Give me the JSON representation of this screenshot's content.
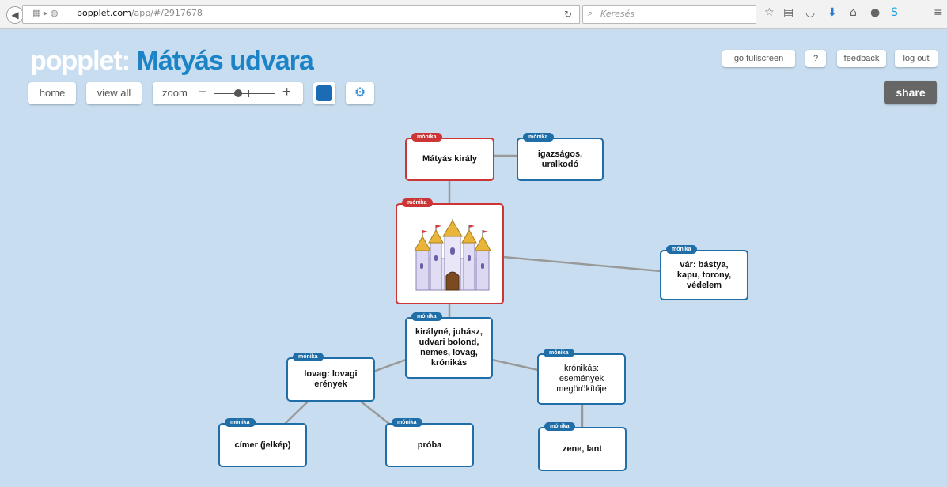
{
  "browser": {
    "url_domain": "popplet.com",
    "url_path": "/app/#/2917678",
    "search_placeholder": "Keresés"
  },
  "app": {
    "brand": "popplet",
    "colon": ":",
    "board_title": "Mátyás udvara"
  },
  "toolbar": {
    "home": "home",
    "view_all": "view all",
    "zoom": "zoom",
    "zoom_minus": "−",
    "zoom_plus": "+",
    "color": "#1b6cb5",
    "settings_icon": "⚙"
  },
  "top_right": {
    "fullscreen": "go fullscreen",
    "help": "?",
    "feedback": "feedback",
    "logout": "log out",
    "share": "share"
  },
  "popplets": [
    {
      "id": "matyas",
      "author": "mónika",
      "text": "Mátyás király",
      "border": "red"
    },
    {
      "id": "igazsagos",
      "author": "mónika",
      "text": "igazságos,\nuralkodó",
      "border": "blue"
    },
    {
      "id": "castle",
      "author": "mónika",
      "text": "",
      "border": "red",
      "icon": "castle-image"
    },
    {
      "id": "var",
      "author": "mónika",
      "text": "vár: bástya,\nkapu, torony,\nvédelem",
      "border": "blue"
    },
    {
      "id": "kiralyne",
      "author": "mónika",
      "text": "királyné, juhász,\nudvari bolond,\nnemes, lovag,\nkrónikás",
      "border": "blue"
    },
    {
      "id": "lovag",
      "author": "mónika",
      "text": "lovag: lovagi\nerények",
      "border": "blue"
    },
    {
      "id": "kronikas",
      "author": "mónika",
      "text": "krónikás:\nesemények\nmegörökítője",
      "border": "blue"
    },
    {
      "id": "cimer",
      "author": "mónika",
      "text": "címer (jelkép)",
      "border": "blue"
    },
    {
      "id": "proba",
      "author": "mónika",
      "text": "próba",
      "border": "blue"
    },
    {
      "id": "zene",
      "author": "mónika",
      "text": "zene, lant",
      "border": "blue"
    }
  ]
}
